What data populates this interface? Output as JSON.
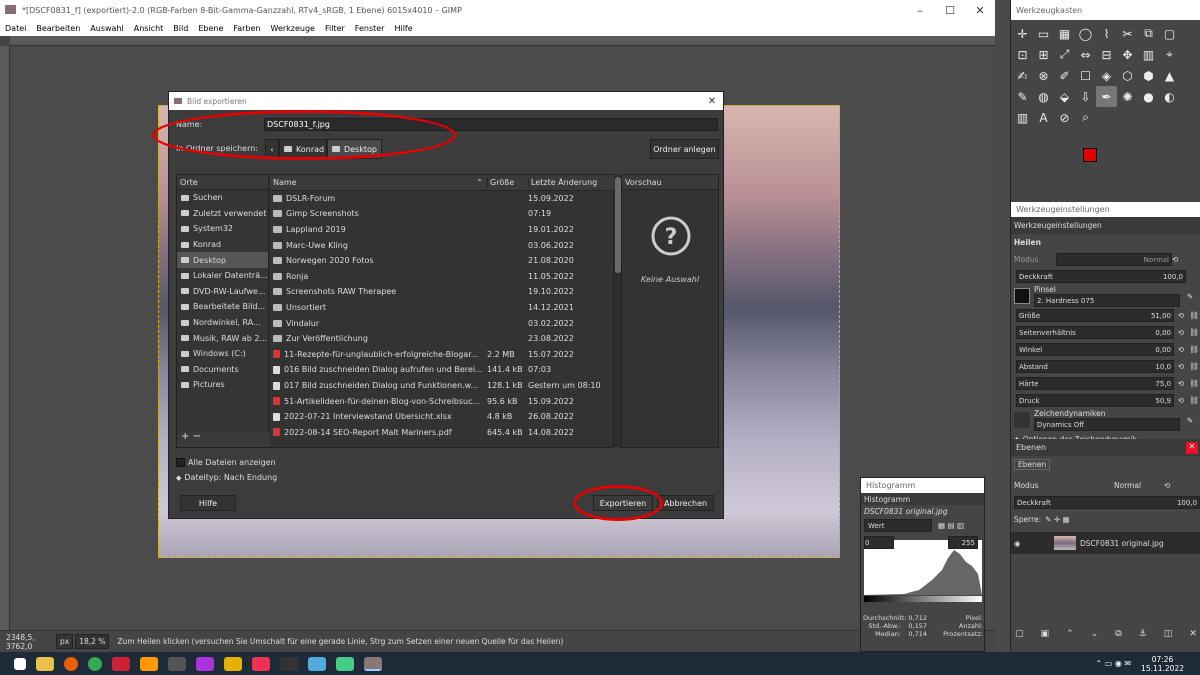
{
  "window": {
    "title": "*[DSCF0831_f] (exportiert)-2.0 (RGB-Farben 8-Bit-Gamma-Ganzzahl, RTv4_sRGB, 1 Ebene) 6015x4010 – GIMP"
  },
  "menu": [
    "Datei",
    "Bearbeiten",
    "Auswahl",
    "Ansicht",
    "Bild",
    "Ebene",
    "Farben",
    "Werkzeuge",
    "Filter",
    "Fenster",
    "Hilfe"
  ],
  "dialog": {
    "title": "Bild exportieren",
    "name_label": "Name:",
    "name_value": "DSCF0831_f.jpg",
    "folder_label": "In Ordner speichern:",
    "crumbs": [
      "Konrad",
      "Desktop"
    ],
    "create_folder": "Ordner anlegen",
    "places_header": "Orte",
    "places": [
      "Suchen",
      "Zuletzt verwendet",
      "System32",
      "Konrad",
      "Desktop",
      "Lokaler Datenträ...",
      "DVD-RW-Laufwe...",
      "Bearbeitete Bild...",
      "Nordwinkel, RA...",
      "Musik, RAW ab 2...",
      "Windows (C:)",
      "Documents",
      "Pictures"
    ],
    "columns": {
      "name": "Name",
      "size": "Größe",
      "modified": "Letzte Änderung"
    },
    "files": [
      {
        "name": "DSLR-Forum",
        "size": "",
        "date": "15.09.2022",
        "type": "folder"
      },
      {
        "name": "Gimp Screenshots",
        "size": "",
        "date": "07:19",
        "type": "folder"
      },
      {
        "name": "Lappland 2019",
        "size": "",
        "date": "19.01.2022",
        "type": "folder"
      },
      {
        "name": "Marc-Uwe Kling",
        "size": "",
        "date": "03.06.2022",
        "type": "folder"
      },
      {
        "name": "Norwegen 2020 Fotos",
        "size": "",
        "date": "21.08.2020",
        "type": "folder"
      },
      {
        "name": "Ronja",
        "size": "",
        "date": "11.05.2022",
        "type": "folder"
      },
      {
        "name": "Screenshots RAW Therapee",
        "size": "",
        "date": "19.10.2022",
        "type": "folder"
      },
      {
        "name": "Unsortiert",
        "size": "",
        "date": "14.12.2021",
        "type": "folder"
      },
      {
        "name": "Vindalur",
        "size": "",
        "date": "03.02.2022",
        "type": "folder"
      },
      {
        "name": "Zur Veröffentlichung",
        "size": "",
        "date": "23.08.2022",
        "type": "folder"
      },
      {
        "name": "11-Rezepte-für-unglaublich-erfolgreiche-Blogar...",
        "size": "2.2 MB",
        "date": "15.07.2022",
        "type": "pdf"
      },
      {
        "name": "016 Bild zuschneiden Dialog aufrufen und Berei...",
        "size": "141.4 kB",
        "date": "07:03",
        "type": "doc"
      },
      {
        "name": "017 Bild zuschneiden Dialog und Funktionen.w...",
        "size": "128.1 kB",
        "date": "Gestern um 08:10",
        "type": "doc"
      },
      {
        "name": "51-Artikelideen-für-deinen-Blog-von-Schreibsuc...",
        "size": "95.6 kB",
        "date": "15.09.2022",
        "type": "pdf"
      },
      {
        "name": "2022-07-21 Interviewstand Übersicht.xlsx",
        "size": "4.8 kB",
        "date": "26.08.2022",
        "type": "doc"
      },
      {
        "name": "2022-08-14 SEO-Report Malt Mariners.pdf",
        "size": "645.4 kB",
        "date": "14.08.2022",
        "type": "pdf"
      }
    ],
    "preview_header": "Vorschau",
    "preview_empty": "Keine Auswahl",
    "show_all": "Alle Dateien anzeigen",
    "filetype": "Dateityp: Nach Endung",
    "help": "Hilfe",
    "export": "Exportieren",
    "cancel": "Abbrechen"
  },
  "status": {
    "coords": "2348,5, 3762,0",
    "unit": "px",
    "zoom": "18,2 %",
    "message": "Zum Heilen klicken (versuchen Sie Umschalt für eine gerade Linie, Strg zum Setzen einer neuen Quelle für das Heilen)"
  },
  "toolbox": {
    "title": "Werkzeugkasten"
  },
  "tooloptions": {
    "title": "Werkzeugeinstellungen",
    "tab": "Werkzeugeinstellungen",
    "tool": "Heilen",
    "mode_label": "Modus",
    "mode_value": "Normal",
    "opacity_label": "Deckkraft",
    "opacity": "100,0",
    "brush_label": "Pinsel",
    "brush_value": "2. Hardness 075",
    "params": [
      {
        "label": "Größe",
        "value": "51,00"
      },
      {
        "label": "Seitenverhältnis",
        "value": "0,00"
      },
      {
        "label": "Winkel",
        "value": "0,00"
      },
      {
        "label": "Abstand",
        "value": "10,0"
      },
      {
        "label": "Härte",
        "value": "75,0"
      },
      {
        "label": "Druck",
        "value": "50,9"
      }
    ],
    "dynamics_label": "Zeichendynamiken",
    "dynamics_value": "Dynamics Off",
    "more": "Optionen der Zeichendynamik"
  },
  "layers": {
    "title": "Ebenen",
    "tab": "Ebenen",
    "mode_label": "Modus",
    "mode_value": "Normal",
    "opacity_label": "Deckkraft",
    "opacity": "100,0",
    "lock_label": "Sperre:",
    "layer_name": "DSCF0831 original.jpg"
  },
  "histogram": {
    "title": "Histogramm",
    "tab": "Histogramm",
    "image": "DSCF0831 original.jpg",
    "channel": "Wert",
    "min": "0",
    "max": "255",
    "stats": [
      {
        "label": "Durchschnitt:",
        "value": "0,712"
      },
      {
        "label": "Std.-Abw.:",
        "value": "0,157"
      },
      {
        "label": "Median:",
        "value": "0,714"
      }
    ],
    "stats2": [
      {
        "label": "Pixel:"
      },
      {
        "label": "Anzahl:"
      },
      {
        "label": "Prozentsatz:"
      }
    ]
  },
  "taskbar": {
    "time": "07:26",
    "date": "15.11.2022"
  },
  "colors": {
    "accent": "#e40000",
    "fg": "#e00000",
    "bg": "#ffffff"
  }
}
